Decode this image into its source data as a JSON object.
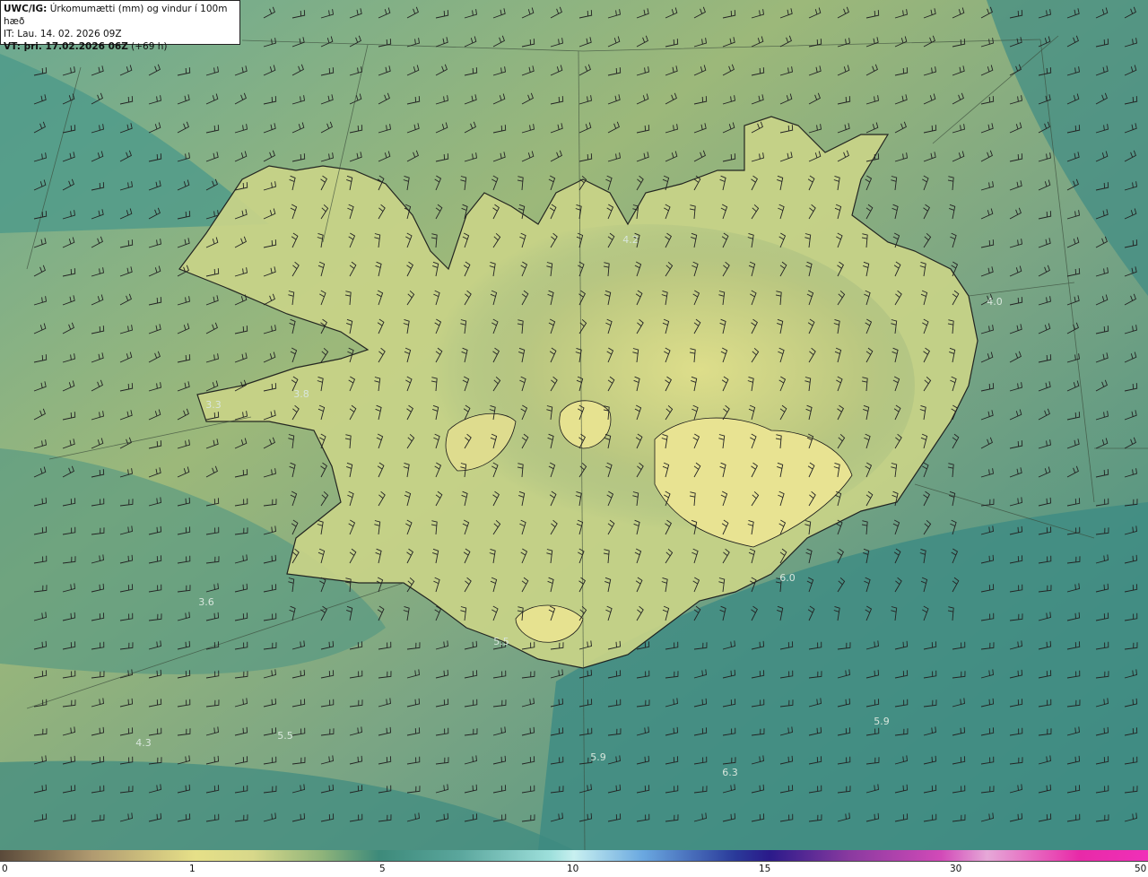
{
  "header": {
    "line1_bold": "UWC/IG:",
    "line1_rest": " Úrkomumætti (mm) og vindur í 100m hæð",
    "line2": "IT: Lau. 14. 02. 2026 09Z",
    "line3_bold": "VT: þri. 17.02.2026 06Z",
    "line3_rest": " (+69 h)"
  },
  "map_labels": [
    "4.2",
    "4.0",
    "3.8",
    "3.3",
    "3.6",
    "5.5",
    "6.0",
    "5.5",
    "4.3",
    "5.9",
    "6.3",
    "5.9"
  ],
  "colorbar": {
    "ticks": [
      "0",
      "1",
      "5",
      "10",
      "15",
      "30",
      "50"
    ]
  },
  "colors": {
    "land": "#cfd88a",
    "sea": "#3f8c84",
    "coast": "#1a1a1a",
    "barb": "#222222"
  }
}
